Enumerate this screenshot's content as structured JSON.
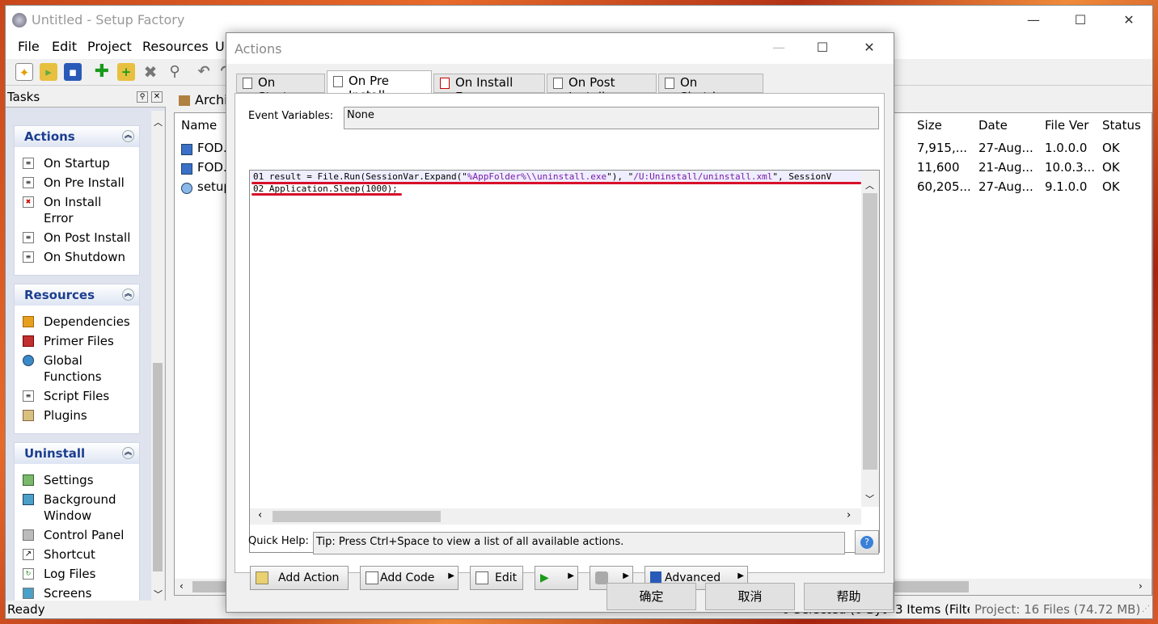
{
  "app": {
    "title": "Untitled - Setup Factory",
    "menu": [
      "File",
      "Edit",
      "Project",
      "Resources",
      "Ur"
    ]
  },
  "tasks": {
    "title": "Tasks",
    "actions": {
      "title": "Actions",
      "items": [
        "On Startup",
        "On Pre Install",
        "On Install\nError",
        "On Post Install",
        "On Shutdown"
      ]
    },
    "resources": {
      "title": "Resources",
      "items": [
        "Dependencies",
        "Primer Files",
        "Global\nFunctions",
        "Script Files",
        "Plugins"
      ]
    },
    "uninstall": {
      "title": "Uninstall",
      "items": [
        "Settings",
        "Background\nWindow",
        "Control Panel",
        "Shortcut",
        "Log Files",
        "Screens"
      ]
    }
  },
  "archive": {
    "tab": "Archi",
    "columns": [
      "Name",
      "Size",
      "Date",
      "File Ver",
      "Status"
    ],
    "rows": [
      {
        "name": "FOD.e",
        "size": "7,915,...",
        "date": "27-Aug...",
        "ver": "1.0.0.0",
        "status": "OK"
      },
      {
        "name": "FOD.v",
        "size": "11,600",
        "date": "21-Aug...",
        "ver": "10.0.3...",
        "status": "OK"
      },
      {
        "name": "setup",
        "size": "60,205...",
        "date": "27-Aug...",
        "ver": "9.1.0.0",
        "status": "OK"
      }
    ]
  },
  "status": {
    "ready": "Ready",
    "selected": "0 Selected (0 Byt",
    "items": "3 Items (Filter",
    "project": "Project: 16 Files (74.72 MB)"
  },
  "dialog": {
    "title": "Actions",
    "tabs": [
      "On Startup",
      "On Pre Install",
      "On Install Error",
      "On Post Install",
      "On Shutdown"
    ],
    "event_label": "Event Variables:",
    "event_value": "None",
    "code": {
      "line1_a": "01 result = File.Run(SessionVar.Expand(\"",
      "line1_b": "%AppFolder%\\\\uninstall.exe",
      "line1_c": "\"), \"",
      "line1_d": "/U:Uninstall/uninstall.xml",
      "line1_e": "\", SessionV",
      "line2": "02 Application.Sleep(1000);"
    },
    "quickhelp_label": "Quick Help:",
    "quickhelp_text": "Tip: Press Ctrl+Space to view a list of all available actions.",
    "buttons": {
      "add_action": "Add Action",
      "add_code": "Add Code",
      "edit": "Edit",
      "advanced": "Advanced"
    },
    "ok": "确定",
    "cancel": "取消",
    "help": "帮助"
  },
  "colors": {
    "accent": "#1c3e8f",
    "annotation": "#d8102a",
    "string": "#7a1aa5"
  }
}
